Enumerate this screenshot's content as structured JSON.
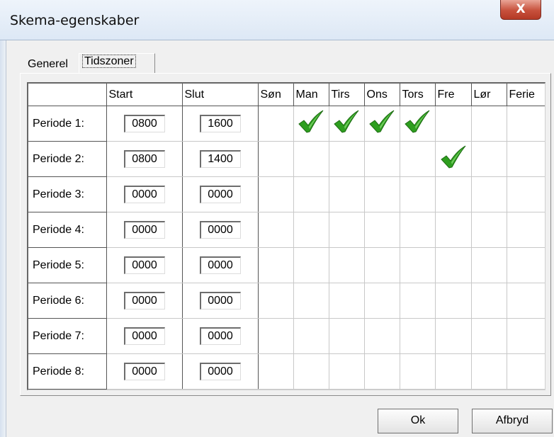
{
  "window": {
    "title": "Skema-egenskaber",
    "close_glyph": "X"
  },
  "tabs": [
    {
      "label": "Generel",
      "active": false
    },
    {
      "label": "Tidszoner",
      "active": true
    }
  ],
  "grid": {
    "headers": [
      "",
      "Start",
      "Slut",
      "Søn",
      "Man",
      "Tirs",
      "Ons",
      "Tors",
      "Fre",
      "Lør",
      "Ferie"
    ],
    "rows": [
      {
        "label": "Periode 1:",
        "start": "0800",
        "slut": "1600",
        "days": [
          false,
          true,
          true,
          true,
          true,
          false,
          false,
          false
        ]
      },
      {
        "label": "Periode 2:",
        "start": "0800",
        "slut": "1400",
        "days": [
          false,
          false,
          false,
          false,
          false,
          true,
          false,
          false
        ]
      },
      {
        "label": "Periode 3:",
        "start": "0000",
        "slut": "0000",
        "days": [
          false,
          false,
          false,
          false,
          false,
          false,
          false,
          false
        ]
      },
      {
        "label": "Periode 4:",
        "start": "0000",
        "slut": "0000",
        "days": [
          false,
          false,
          false,
          false,
          false,
          false,
          false,
          false
        ]
      },
      {
        "label": "Periode 5:",
        "start": "0000",
        "slut": "0000",
        "days": [
          false,
          false,
          false,
          false,
          false,
          false,
          false,
          false
        ]
      },
      {
        "label": "Periode 6:",
        "start": "0000",
        "slut": "0000",
        "days": [
          false,
          false,
          false,
          false,
          false,
          false,
          false,
          false
        ]
      },
      {
        "label": "Periode 7:",
        "start": "0000",
        "slut": "0000",
        "days": [
          false,
          false,
          false,
          false,
          false,
          false,
          false,
          false
        ]
      },
      {
        "label": "Periode 8:",
        "start": "0000",
        "slut": "0000",
        "days": [
          false,
          false,
          false,
          false,
          false,
          false,
          false,
          false
        ]
      }
    ],
    "check_icon": "checkmark-icon",
    "check_color": "#2e9e1f"
  },
  "buttons": {
    "ok": "Ok",
    "cancel": "Afbryd"
  }
}
